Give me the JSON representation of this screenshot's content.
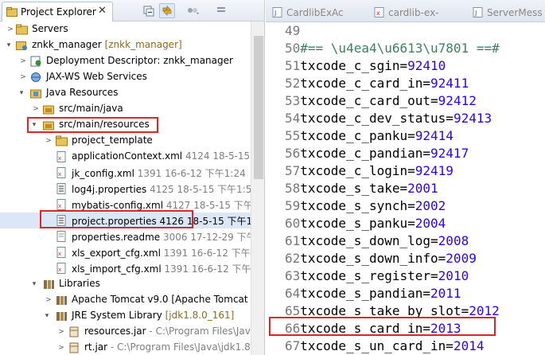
{
  "explorer": {
    "title": "Project Explorer",
    "close_glyph": "✕",
    "toolbar": [
      "collapse-all-icon",
      "link-with-editor-icon",
      "filter-icon",
      "view-menu-icon"
    ],
    "tree": [
      {
        "label": "Servers",
        "meta": "",
        "expanded": false,
        "icon": "folder-icon"
      },
      {
        "label": "znkk_manager",
        "meta": "[znkk_manager]",
        "expanded": true,
        "icon": "project-icon"
      },
      {
        "label": "Deployment Descriptor: znkk_manager",
        "meta": "",
        "expanded": false,
        "icon": "deployment-descriptor-icon"
      },
      {
        "label": "JAX-WS Web Services",
        "meta": "",
        "expanded": false,
        "icon": "web-services-icon"
      },
      {
        "label": "Java Resources",
        "meta": "",
        "expanded": true,
        "icon": "java-resources-icon"
      },
      {
        "label": "src/main/java",
        "meta": "",
        "expanded": false,
        "icon": "source-folder-icon"
      },
      {
        "label": "src/main/resources",
        "meta": "",
        "expanded": true,
        "icon": "source-folder-icon"
      },
      {
        "label": "project_template",
        "meta": "",
        "expanded": false,
        "icon": "folder-icon"
      },
      {
        "label": "applicationContext.xml",
        "meta": "4124  18-5-15",
        "icon": "xml-file-icon"
      },
      {
        "label": "jk_config.xml",
        "meta": "1391  16-6-12 下午1:24",
        "icon": "xml-file-icon"
      },
      {
        "label": "log4j.properties",
        "meta": "4125  18-5-15 下午1:5",
        "icon": "properties-file-icon"
      },
      {
        "label": "mybatis-config.xml",
        "meta": "4127  18-5-15 下午",
        "icon": "xml-file-icon"
      },
      {
        "label": "project.properties",
        "meta": "4126  18-5-15 下午1",
        "icon": "properties-file-icon"
      },
      {
        "label": "properties.readme",
        "meta": "3006  17-12-29 下午",
        "icon": "text-file-icon"
      },
      {
        "label": "xls_export_cfg.xml",
        "meta": "1391  16-6-12 下午1",
        "icon": "xml-file-icon"
      },
      {
        "label": "xls_import_cfg.xml",
        "meta": "1391  16-6-12 下午1",
        "icon": "xml-file-icon"
      },
      {
        "label": "Libraries",
        "meta": "",
        "expanded": true,
        "icon": "libraries-icon"
      },
      {
        "label": "Apache Tomcat v9.0 [Apache Tomcat v",
        "meta": "",
        "expanded": false,
        "icon": "library-icon"
      },
      {
        "label": "JRE System Library",
        "meta": "[jdk1.8.0_161]",
        "expanded": true,
        "icon": "library-icon"
      },
      {
        "label": "resources.jar",
        "meta": "- C:\\Program Files\\Jav",
        "expanded": false,
        "icon": "jar-icon"
      },
      {
        "label": "rt.jar",
        "meta": "- C:\\Program Files\\Java\\jdk1.8",
        "expanded": false,
        "icon": "jar-icon"
      }
    ]
  },
  "editor": {
    "tabs": [
      "CardlibExAc",
      "cardlib-ex-",
      "ServerMess"
    ],
    "lines": [
      {
        "n": "49",
        "key": "",
        "val": ""
      },
      {
        "n": "50",
        "comment": "#== \\u4ea4\\u6613\\u7801 ==#"
      },
      {
        "n": "51",
        "key": "txcode_c_sgin",
        "val": "92410"
      },
      {
        "n": "52",
        "key": "txcode_c_card_in",
        "val": "92411"
      },
      {
        "n": "53",
        "key": "txcode_c_card_out",
        "val": "92412"
      },
      {
        "n": "54",
        "key": "txcode_c_dev_status",
        "val": "92413"
      },
      {
        "n": "55",
        "key": "txcode_c_panku",
        "val": "92414"
      },
      {
        "n": "56",
        "key": "txcode_c_pandian",
        "val": "92417"
      },
      {
        "n": "57",
        "key": "txcode_c_login",
        "val": "92419"
      },
      {
        "n": "58",
        "key": "txcode_s_take",
        "val": "2001"
      },
      {
        "n": "59",
        "key": "txcode_s_synch",
        "val": "2002"
      },
      {
        "n": "60",
        "key": "txcode_s_panku",
        "val": "2004"
      },
      {
        "n": "61",
        "key": "txcode_s_down_log",
        "val": "2008"
      },
      {
        "n": "62",
        "key": "txcode_s_down_info",
        "val": "2009"
      },
      {
        "n": "63",
        "key": "txcode_s_register",
        "val": "2010"
      },
      {
        "n": "64",
        "key": "txcode_s_pandian",
        "val": "2011"
      },
      {
        "n": "65",
        "key": "txcode_s_take_by_slot",
        "val": "2012"
      },
      {
        "n": "66",
        "key": "txcode_s_card_in",
        "val": "2013"
      },
      {
        "n": "67",
        "key": "txcode_s_un_card_in",
        "val": "2014"
      }
    ]
  },
  "colors": {
    "highlight": "#e02424",
    "value": "#2a00ff",
    "line_number": "#787878",
    "selection": "#dbe7f7"
  }
}
